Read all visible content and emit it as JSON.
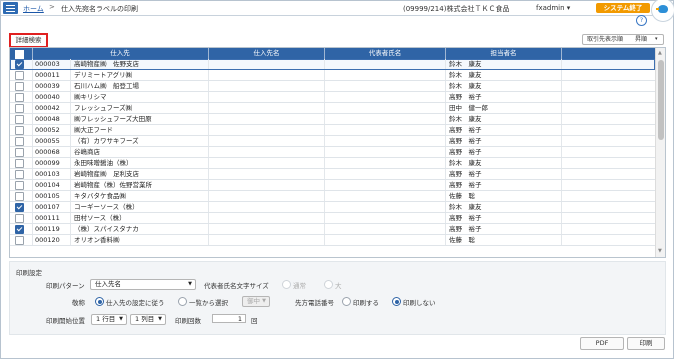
{
  "header": {
    "home": "ホーム",
    "separator": ">",
    "page_title": "仕入先宛名ラベルの印刷",
    "company": "(09999/214)株式会社ＴＫＣ食品",
    "user": "fxadmin",
    "user_caret": "▾",
    "system_end": "システム終了",
    "help": "?"
  },
  "toolbar": {
    "detail_search": "詳細検索",
    "sort_label": "取引先表示順",
    "sort_value": "昇順",
    "sort_caret": "▾"
  },
  "table": {
    "columns": [
      "仕入先",
      "仕入先名",
      "代表者氏名",
      "担当者名"
    ],
    "rows": [
      {
        "checked": true,
        "code": "000003",
        "name": "高崎物産㈱　佐野支店",
        "rep": "",
        "staff": "鈴木　康友",
        "selected": true
      },
      {
        "checked": false,
        "code": "000011",
        "name": "デリミートアグリ㈱",
        "rep": "",
        "staff": "鈴木　康友"
      },
      {
        "checked": false,
        "code": "000039",
        "name": "石川ハム㈱　船登工場",
        "rep": "",
        "staff": "鈴木　康友"
      },
      {
        "checked": false,
        "code": "000040",
        "name": "㈱キリシマ",
        "rep": "",
        "staff": "高野　裕子"
      },
      {
        "checked": false,
        "code": "000042",
        "name": "フレッシュフーズ㈱",
        "rep": "",
        "staff": "田中　健一郎"
      },
      {
        "checked": false,
        "code": "000048",
        "name": "㈱フレッシュフーズ大田原",
        "rep": "",
        "staff": "鈴木　康友"
      },
      {
        "checked": false,
        "code": "000052",
        "name": "㈱大正フード",
        "rep": "",
        "staff": "高野　裕子"
      },
      {
        "checked": false,
        "code": "000055",
        "name": "（有）カワサキフーズ",
        "rep": "",
        "staff": "高野　裕子"
      },
      {
        "checked": false,
        "code": "000068",
        "name": "谷嶋商店",
        "rep": "",
        "staff": "高野　裕子"
      },
      {
        "checked": false,
        "code": "000099",
        "name": "永田味噌醤油（株）",
        "rep": "",
        "staff": "鈴木　康友"
      },
      {
        "checked": false,
        "code": "000103",
        "name": "岩崎物産㈱　足利支店",
        "rep": "",
        "staff": "高野　裕子"
      },
      {
        "checked": false,
        "code": "000104",
        "name": "岩崎物産（株）佐野営業所",
        "rep": "",
        "staff": "高野　裕子"
      },
      {
        "checked": false,
        "code": "000105",
        "name": "キタバタケ食品㈱",
        "rep": "",
        "staff": "佐藤　聡"
      },
      {
        "checked": true,
        "code": "000107",
        "name": "コーギーソース（株）",
        "rep": "",
        "staff": "鈴木　康友"
      },
      {
        "checked": false,
        "code": "000111",
        "name": "田村ソース（株）",
        "rep": "",
        "staff": "高野　裕子"
      },
      {
        "checked": true,
        "code": "000119",
        "name": "（株）スパイスタナカ",
        "rep": "",
        "staff": "高野　裕子"
      },
      {
        "checked": false,
        "code": "000120",
        "name": "オリオン香料㈱",
        "rep": "",
        "staff": "佐藤　聡"
      }
    ]
  },
  "print_settings": {
    "section_title": "印刷設定",
    "pattern_label": "印刷パターン",
    "pattern_value": "仕入先名",
    "rep_size_label": "代表者氏名文字サイズ",
    "size_normal": "通常",
    "size_large": "大",
    "title_label": "敬称",
    "title_opt1": "仕入先の設定に従う",
    "title_opt2": "一覧から選択",
    "title_opt2_value": "御中",
    "phone_label": "先方電話番号",
    "phone_print": "印刷する",
    "phone_noprint": "印刷しない",
    "start_label": "印刷開始位置",
    "start_row": "1 行目",
    "start_col": "1 列目",
    "count_label": "印刷回数",
    "count_value": "1",
    "count_unit": "回"
  },
  "footer": {
    "pdf": "PDF",
    "print": "印刷"
  }
}
